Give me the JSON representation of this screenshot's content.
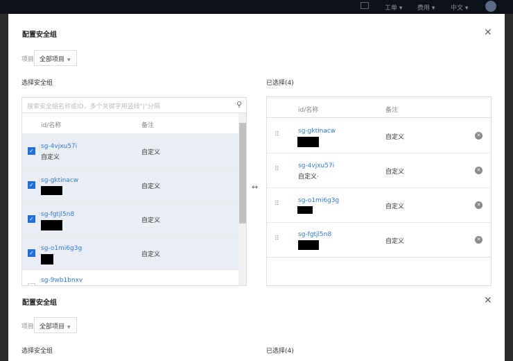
{
  "topbar": {
    "items": [
      "工单 ▾",
      "费用 ▾",
      "中文 ▾"
    ]
  },
  "dialog": {
    "title": "配置安全组",
    "project_label": "项目",
    "project_value": "全部项目",
    "left_title": "选择安全组",
    "right_title": "已选择(4)",
    "search_placeholder": "搜索安全组名称或ID，多个关键字用竖线\"|\"分隔",
    "col_id": "id/名称",
    "col_note": "备注",
    "available": [
      {
        "id": "sg-4vjxu57i",
        "name": "自定义",
        "note": "自定义",
        "checked": true
      },
      {
        "id": "sg-gktinacw",
        "name": "",
        "note": "自定义",
        "checked": true
      },
      {
        "id": "sg-fgtjl5n8",
        "name": "",
        "note": "自定义",
        "checked": true
      },
      {
        "id": "sg-o1mi6g3g",
        "name": "",
        "note": "自定义",
        "checked": true
      },
      {
        "id": "sg-9wb1bnxv",
        "name": "",
        "note": "",
        "checked": false
      }
    ],
    "selected": [
      {
        "id": "sg-gktinacw",
        "name": "",
        "note": "自定义"
      },
      {
        "id": "sg-4vjxu57i",
        "name": "自定义·",
        "note": "自定义"
      },
      {
        "id": "sg-o1mi6g3g",
        "name": "",
        "note": "自定义"
      },
      {
        "id": "sg-fgtjl5n8",
        "name": "",
        "note": "自定义"
      }
    ]
  },
  "colors": {
    "accent": "#1e6fd9",
    "link": "#2f79d8",
    "selected_row": "#eaeef4"
  }
}
